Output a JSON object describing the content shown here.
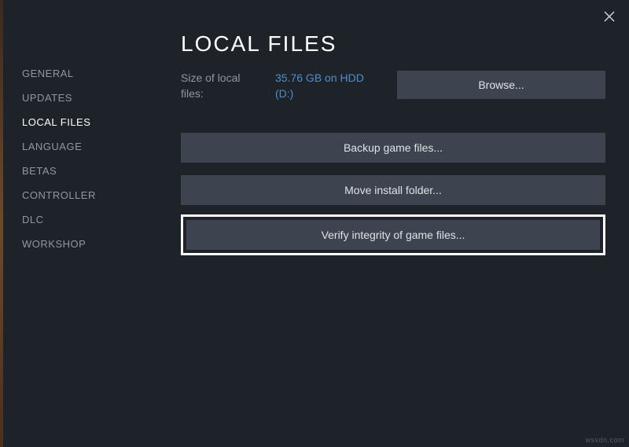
{
  "sidebar": {
    "items": [
      {
        "label": "GENERAL"
      },
      {
        "label": "UPDATES"
      },
      {
        "label": "LOCAL FILES"
      },
      {
        "label": "LANGUAGE"
      },
      {
        "label": "BETAS"
      },
      {
        "label": "CONTROLLER"
      },
      {
        "label": "DLC"
      },
      {
        "label": "WORKSHOP"
      }
    ],
    "active_index": 2
  },
  "main": {
    "title": "LOCAL FILES",
    "size_label": "Size of local files:",
    "size_value": "35.76 GB on HDD (D:)",
    "browse_label": "Browse...",
    "backup_label": "Backup game files...",
    "move_label": "Move install folder...",
    "verify_label": "Verify integrity of game files..."
  },
  "watermark": "wsxdn.com"
}
